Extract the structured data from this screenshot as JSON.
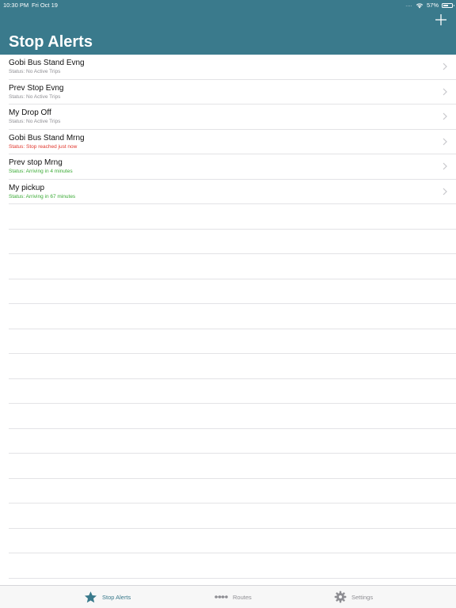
{
  "status_bar": {
    "time": "10:30 PM",
    "date": "Fri Oct 19",
    "signal": "....",
    "battery_level": "57%",
    "battery_fraction": 0.57
  },
  "header": {
    "title": "Stop Alerts",
    "add_icon": "plus-icon"
  },
  "colors": {
    "header_bg": "#3a7a8c",
    "tab_active": "#3a7a8c",
    "tab_inactive": "#8e8e93",
    "status_neutral": "#8e8e93",
    "status_alert": "#e0362c",
    "status_ok": "#3aaa35"
  },
  "alerts": [
    {
      "title": "Gobi Bus Stand Evng",
      "status": "Status: No Active Trips",
      "status_color": "#8e8e93"
    },
    {
      "title": "Prev Stop Evng",
      "status": "Status: No Active Trips",
      "status_color": "#8e8e93"
    },
    {
      "title": "My Drop Off",
      "status": "Status: No Active Trips",
      "status_color": "#8e8e93"
    },
    {
      "title": "Gobi Bus Stand Mrng",
      "status": "Status: Stop reached just now",
      "status_color": "#e0362c"
    },
    {
      "title": "Prev stop Mrng",
      "status": "Status: Arriving in 4 minutes",
      "status_color": "#3aaa35"
    },
    {
      "title": "My pickup",
      "status": "Status: Arriving in 67 minutes",
      "status_color": "#3aaa35"
    }
  ],
  "tab_bar": {
    "tabs": [
      {
        "label": "Stop Alerts",
        "icon": "star-icon",
        "active": true
      },
      {
        "label": "Routes",
        "icon": "route-icon",
        "active": false
      },
      {
        "label": "Settings",
        "icon": "gear-icon",
        "active": false
      }
    ]
  }
}
